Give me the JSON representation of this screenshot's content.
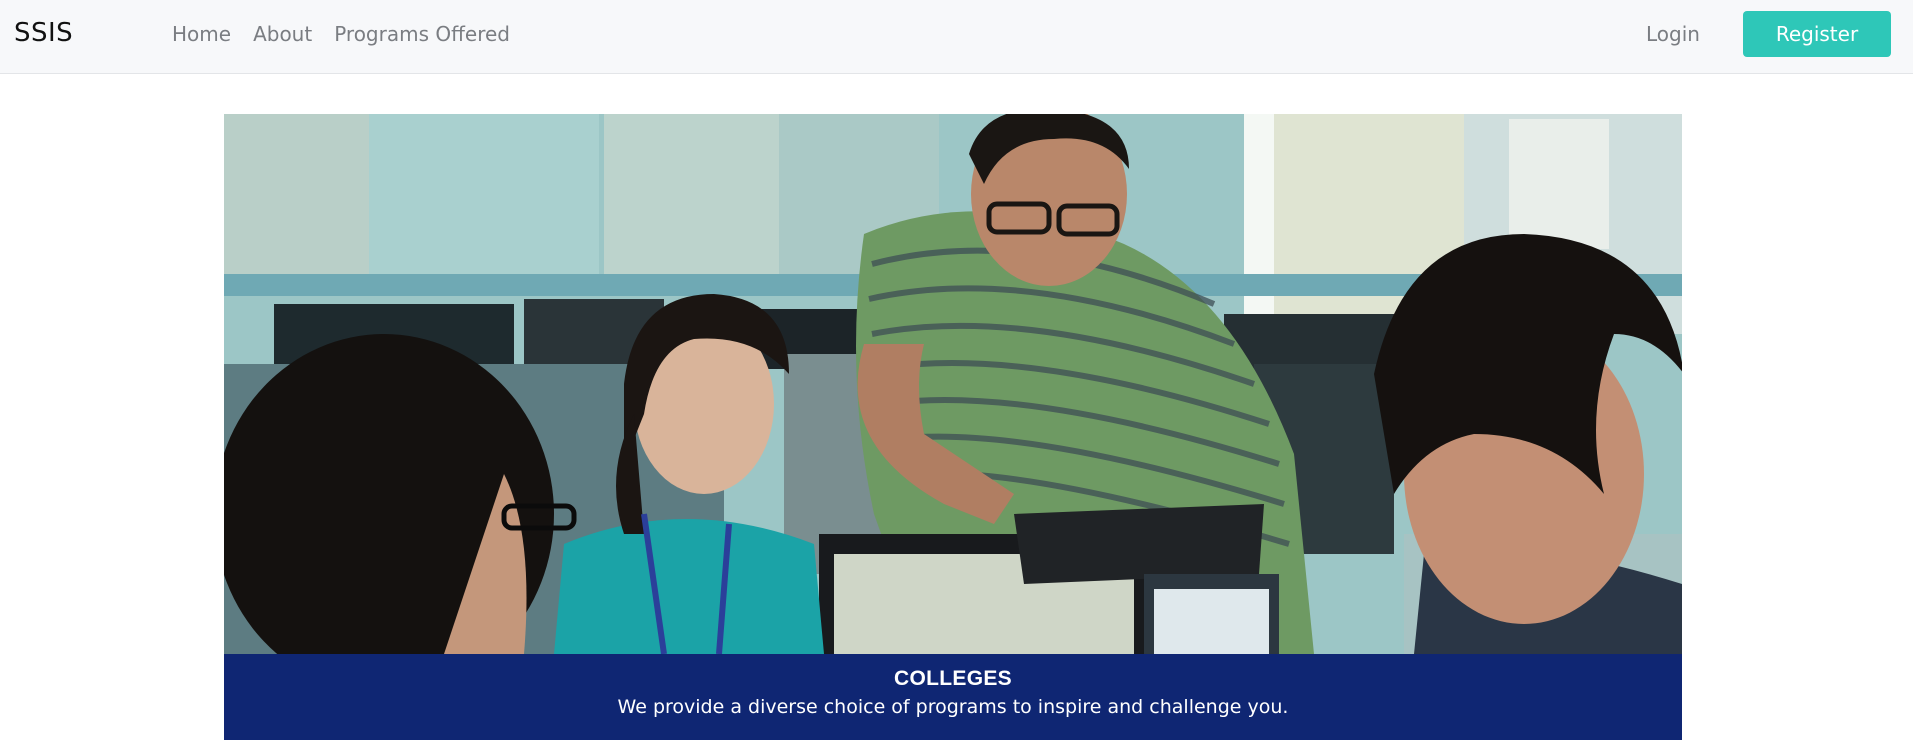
{
  "brand": "SSIS",
  "nav": {
    "home": "Home",
    "about": "About",
    "programs": "Programs Offered",
    "login": "Login",
    "register": "Register"
  },
  "hero": {
    "title": "COLLEGES",
    "text": "We provide a diverse choice of programs to inspire and challenge you."
  },
  "colors": {
    "accent": "#2ec7b8",
    "caption_bg": "#0f2673",
    "navbar_bg": "#f7f8fa"
  }
}
